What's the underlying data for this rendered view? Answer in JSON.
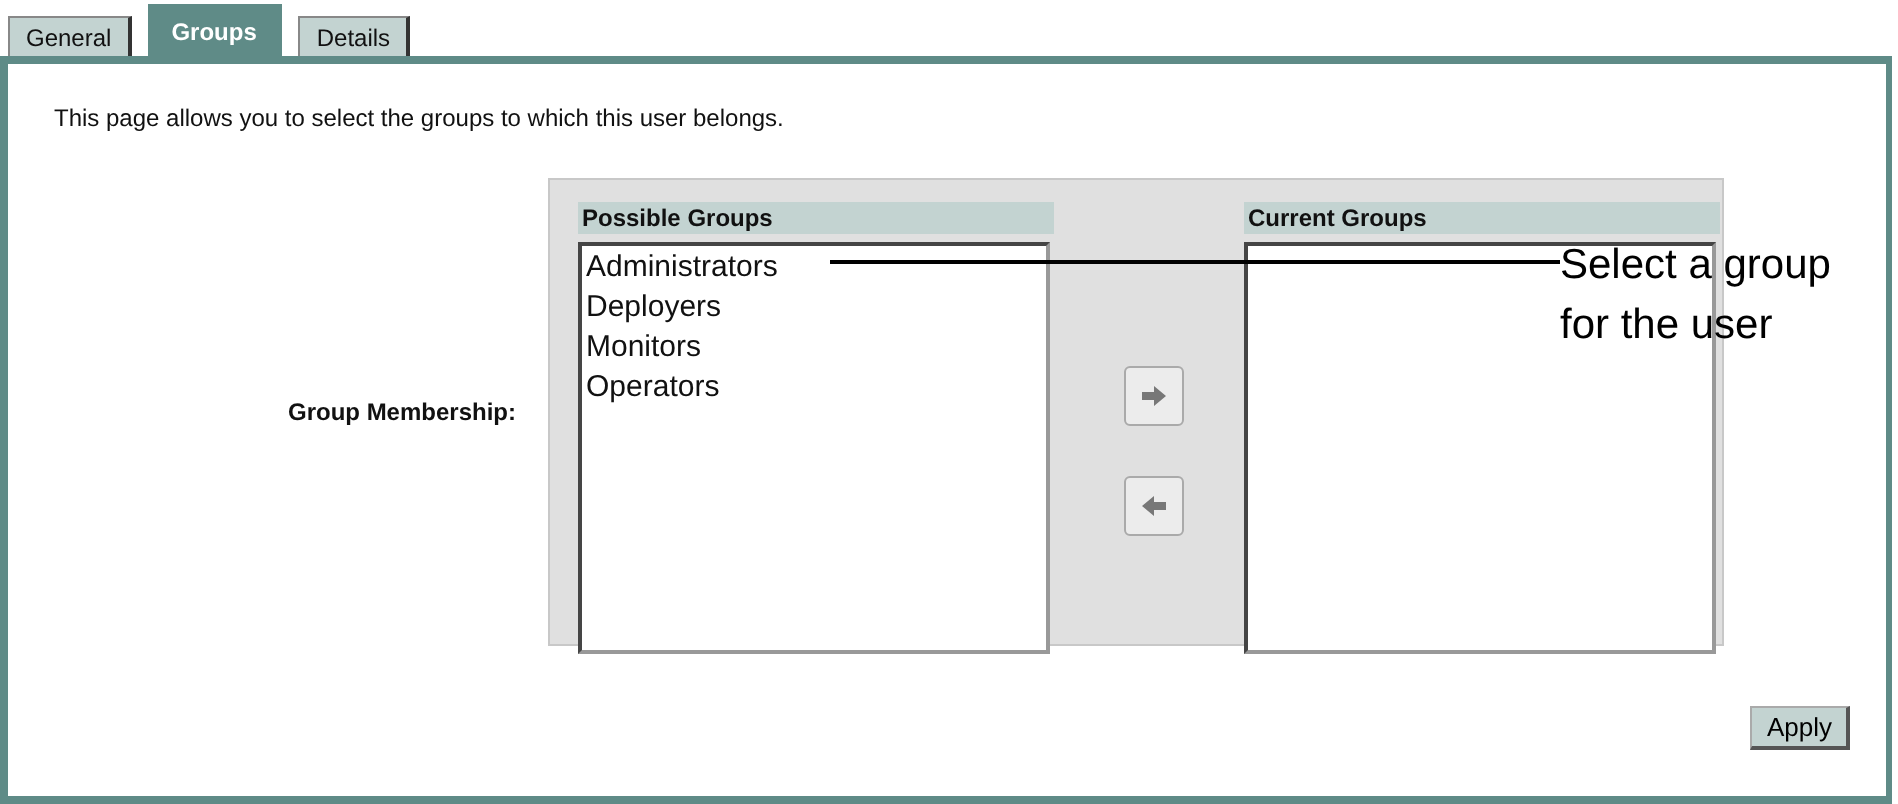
{
  "tabs": [
    {
      "label": "General",
      "selected": false
    },
    {
      "label": "Groups",
      "selected": true
    },
    {
      "label": "Details",
      "selected": false
    }
  ],
  "intro": "This page allows you to select the groups to which this user belongs.",
  "membership_label": "Group Membership:",
  "possible_groups": {
    "title": "Possible Groups",
    "items": [
      {
        "label": "Administrators",
        "selected": false
      },
      {
        "label": "Deployers",
        "selected": false
      },
      {
        "label": "Monitors",
        "selected": false
      },
      {
        "label": "Operators",
        "selected": false
      }
    ]
  },
  "current_groups": {
    "title": "Current Groups"
  },
  "callout": "Select a group for the user",
  "apply_button": "Apply"
}
